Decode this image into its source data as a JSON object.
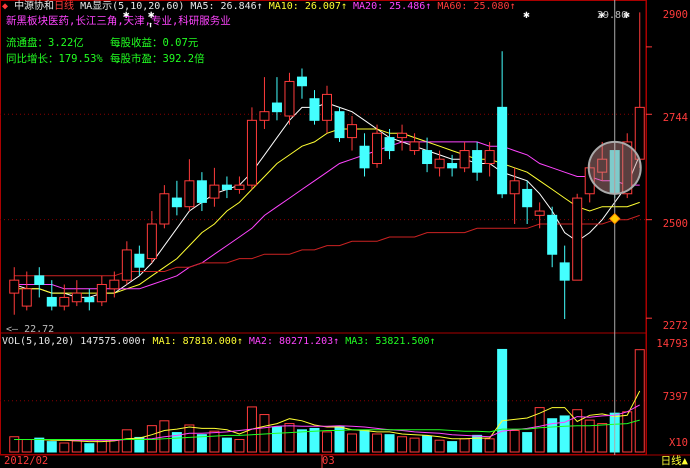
{
  "stock": {
    "name": "中源协和",
    "period": "日线",
    "ma_title": "MA显示(5,10,20,60)",
    "ma5": "MA5: 26.846↑",
    "ma10": "MA10: 26.007↑",
    "ma20": "MA20: 25.486↑",
    "ma60": "MA60: 25.080↑"
  },
  "info": {
    "tags": "新黑板块医药,长江三角,天津,专业,科研服务业",
    "float_label": "流通盘：",
    "float_value": "3.22亿",
    "eps_label": "每股收益：",
    "eps_value": "0.07元",
    "growth_label": "同比增长：",
    "growth_value": "179.53%",
    "pe_label": "每股市盈：",
    "pe_value": "392.2倍"
  },
  "price_axis": {
    "top": "2900",
    "mid1": "2744",
    "mid2": "2500",
    "bottom": "2272"
  },
  "annotations": {
    "high": "29.80",
    "low": "22.72"
  },
  "volume": {
    "title": "VOL(5,10,20)",
    "vol": "147575.000↑",
    "ma1": "MA1: 87810.000↑",
    "ma2": "MA2: 80271.203↑",
    "ma3": "MA3: 53821.500↑",
    "axis_top": "14793",
    "axis_mid": "7397",
    "axis_unit": "X10"
  },
  "bottom": {
    "date_left": "2012/02",
    "date_mid": "03",
    "period_tab": "日线"
  },
  "colors": {
    "up": "#ff3b3b",
    "down": "#44ffff",
    "ma5": "#ffffff",
    "ma10": "#ffff33",
    "ma20": "#ff44ff",
    "ma60": "#cc2222"
  },
  "candles": [
    {
      "o": 23.3,
      "c": 23.6,
      "h": 23.9,
      "l": 22.8,
      "v": 2200
    },
    {
      "o": 23.0,
      "c": 23.4,
      "h": 23.8,
      "l": 22.9,
      "v": 1800
    },
    {
      "o": 23.7,
      "c": 23.5,
      "h": 23.9,
      "l": 23.2,
      "v": 2000
    },
    {
      "o": 23.2,
      "c": 23.0,
      "h": 23.6,
      "l": 22.9,
      "v": 1500
    },
    {
      "o": 23.0,
      "c": 23.2,
      "h": 23.5,
      "l": 22.9,
      "v": 1300
    },
    {
      "o": 23.1,
      "c": 23.3,
      "h": 23.6,
      "l": 23.0,
      "v": 1600
    },
    {
      "o": 23.2,
      "c": 23.1,
      "h": 23.4,
      "l": 22.9,
      "v": 1200
    },
    {
      "o": 23.1,
      "c": 23.5,
      "h": 23.7,
      "l": 23.0,
      "v": 1800
    },
    {
      "o": 23.4,
      "c": 23.6,
      "h": 23.8,
      "l": 23.2,
      "v": 1700
    },
    {
      "o": 23.6,
      "c": 24.3,
      "h": 24.5,
      "l": 23.5,
      "v": 3200
    },
    {
      "o": 24.2,
      "c": 23.9,
      "h": 24.4,
      "l": 23.7,
      "v": 2100
    },
    {
      "o": 24.1,
      "c": 24.9,
      "h": 25.2,
      "l": 24.0,
      "v": 3800
    },
    {
      "o": 24.9,
      "c": 25.6,
      "h": 25.8,
      "l": 24.8,
      "v": 4500
    },
    {
      "o": 25.5,
      "c": 25.3,
      "h": 25.9,
      "l": 25.1,
      "v": 2800
    },
    {
      "o": 25.3,
      "c": 25.9,
      "h": 26.4,
      "l": 25.2,
      "v": 3900
    },
    {
      "o": 25.9,
      "c": 25.4,
      "h": 26.1,
      "l": 25.2,
      "v": 2500
    },
    {
      "o": 25.5,
      "c": 25.8,
      "h": 26.2,
      "l": 25.3,
      "v": 3000
    },
    {
      "o": 25.8,
      "c": 25.7,
      "h": 26.0,
      "l": 25.5,
      "v": 2000
    },
    {
      "o": 25.7,
      "c": 25.8,
      "h": 26.0,
      "l": 25.6,
      "v": 1800
    },
    {
      "o": 25.8,
      "c": 27.3,
      "h": 27.6,
      "l": 25.7,
      "v": 6500
    },
    {
      "o": 27.3,
      "c": 27.5,
      "h": 28.3,
      "l": 27.1,
      "v": 5400
    },
    {
      "o": 27.7,
      "c": 27.5,
      "h": 28.3,
      "l": 27.3,
      "v": 3600
    },
    {
      "o": 27.4,
      "c": 28.2,
      "h": 28.4,
      "l": 27.2,
      "v": 4100
    },
    {
      "o": 28.3,
      "c": 28.1,
      "h": 28.5,
      "l": 27.8,
      "v": 3200
    },
    {
      "o": 27.8,
      "c": 27.3,
      "h": 28.0,
      "l": 27.2,
      "v": 3400
    },
    {
      "o": 27.3,
      "c": 27.9,
      "h": 28.1,
      "l": 27.0,
      "v": 2900
    },
    {
      "o": 27.5,
      "c": 26.9,
      "h": 27.6,
      "l": 26.8,
      "v": 3700
    },
    {
      "o": 26.9,
      "c": 27.2,
      "h": 27.4,
      "l": 26.6,
      "v": 2600
    },
    {
      "o": 26.7,
      "c": 26.2,
      "h": 27.0,
      "l": 26.0,
      "v": 3100
    },
    {
      "o": 26.3,
      "c": 27.0,
      "h": 27.2,
      "l": 26.2,
      "v": 2600
    },
    {
      "o": 26.9,
      "c": 26.6,
      "h": 27.1,
      "l": 26.4,
      "v": 2500
    },
    {
      "o": 26.9,
      "c": 27.0,
      "h": 27.2,
      "l": 26.6,
      "v": 2200
    },
    {
      "o": 26.6,
      "c": 26.8,
      "h": 27.0,
      "l": 26.5,
      "v": 2000
    },
    {
      "o": 26.6,
      "c": 26.3,
      "h": 26.9,
      "l": 26.1,
      "v": 2300
    },
    {
      "o": 26.2,
      "c": 26.4,
      "h": 26.6,
      "l": 26.0,
      "v": 1700
    },
    {
      "o": 26.3,
      "c": 26.2,
      "h": 26.5,
      "l": 26.0,
      "v": 1500
    },
    {
      "o": 26.2,
      "c": 26.6,
      "h": 26.8,
      "l": 26.1,
      "v": 1900
    },
    {
      "o": 26.6,
      "c": 26.1,
      "h": 26.8,
      "l": 25.9,
      "v": 2400
    },
    {
      "o": 26.3,
      "c": 26.6,
      "h": 26.8,
      "l": 26.0,
      "v": 1900
    },
    {
      "o": 27.6,
      "c": 25.6,
      "h": 28.9,
      "l": 25.5,
      "v": 14793
    },
    {
      "o": 25.6,
      "c": 25.9,
      "h": 26.2,
      "l": 24.9,
      "v": 3100
    },
    {
      "o": 25.7,
      "c": 25.3,
      "h": 25.9,
      "l": 24.9,
      "v": 2800
    },
    {
      "o": 25.1,
      "c": 25.2,
      "h": 25.4,
      "l": 24.8,
      "v": 6400
    },
    {
      "o": 25.1,
      "c": 24.2,
      "h": 25.3,
      "l": 23.9,
      "v": 4800
    },
    {
      "o": 24.0,
      "c": 23.6,
      "h": 24.4,
      "l": 22.7,
      "v": 5200
    },
    {
      "o": 23.6,
      "c": 25.5,
      "h": 25.6,
      "l": 23.6,
      "v": 6100
    },
    {
      "o": 25.6,
      "c": 26.2,
      "h": 26.3,
      "l": 25.4,
      "v": 4600
    },
    {
      "o": 26.1,
      "c": 26.4,
      "h": 26.8,
      "l": 25.9,
      "v": 4100
    },
    {
      "o": 26.6,
      "c": 25.6,
      "h": 26.8,
      "l": 25.5,
      "v": 5600
    },
    {
      "o": 25.6,
      "c": 26.8,
      "h": 27.0,
      "l": 25.5,
      "v": 5800
    },
    {
      "o": 26.4,
      "c": 27.6,
      "h": 29.8,
      "l": 26.2,
      "v": 14757
    }
  ],
  "ma_lines": {
    "ma5": [
      23.5,
      23.4,
      23.4,
      23.3,
      23.3,
      23.2,
      23.2,
      23.3,
      23.3,
      23.5,
      23.7,
      24.0,
      24.4,
      24.8,
      25.2,
      25.4,
      25.6,
      25.7,
      25.8,
      26.1,
      26.5,
      26.9,
      27.3,
      27.6,
      27.6,
      27.7,
      27.6,
      27.5,
      27.3,
      27.1,
      26.9,
      26.8,
      26.7,
      26.6,
      26.5,
      26.4,
      26.4,
      26.3,
      26.3,
      26.1,
      26.0,
      25.9,
      25.6,
      25.2,
      24.7,
      24.5,
      24.7,
      25.0,
      25.4,
      25.8,
      26.5
    ],
    "ma10": [
      23.4,
      23.4,
      23.4,
      23.3,
      23.3,
      23.3,
      23.3,
      23.3,
      23.3,
      23.4,
      23.5,
      23.7,
      23.9,
      24.1,
      24.4,
      24.7,
      24.9,
      25.2,
      25.4,
      25.7,
      26.0,
      26.3,
      26.5,
      26.7,
      26.8,
      27.0,
      27.1,
      27.1,
      27.1,
      27.1,
      27.0,
      27.0,
      26.9,
      26.8,
      26.7,
      26.6,
      26.5,
      26.4,
      26.4,
      26.3,
      26.2,
      26.1,
      25.9,
      25.7,
      25.5,
      25.3,
      25.2,
      25.3,
      25.3,
      25.3,
      25.4
    ],
    "ma20": [
      23.5,
      23.5,
      23.5,
      23.5,
      23.4,
      23.4,
      23.4,
      23.4,
      23.4,
      23.4,
      23.4,
      23.5,
      23.6,
      23.7,
      23.9,
      24.0,
      24.2,
      24.4,
      24.6,
      24.8,
      25.1,
      25.3,
      25.5,
      25.7,
      25.9,
      26.1,
      26.3,
      26.4,
      26.5,
      26.6,
      26.7,
      26.8,
      26.8,
      26.8,
      26.8,
      26.8,
      26.8,
      26.8,
      26.7,
      26.7,
      26.6,
      26.5,
      26.3,
      26.2,
      26.1,
      26.0,
      26.0,
      25.9,
      25.9,
      25.8,
      25.8
    ],
    "ma60": [
      23.7,
      23.7,
      23.7,
      23.7,
      23.7,
      23.7,
      23.7,
      23.7,
      23.7,
      23.8,
      23.8,
      23.8,
      23.8,
      23.9,
      23.9,
      24.0,
      24.0,
      24.0,
      24.1,
      24.1,
      24.2,
      24.2,
      24.2,
      24.3,
      24.3,
      24.4,
      24.4,
      24.5,
      24.5,
      24.5,
      24.6,
      24.6,
      24.6,
      24.7,
      24.7,
      24.7,
      24.7,
      24.8,
      24.8,
      24.8,
      24.8,
      24.8,
      24.9,
      24.9,
      24.9,
      24.9,
      24.9,
      24.9,
      25.0,
      25.0,
      25.1
    ]
  },
  "vol_ma": {
    "ma1": [
      1800,
      1800,
      1800,
      1700,
      1700,
      1600,
      1500,
      1500,
      1600,
      1900,
      2000,
      2500,
      3100,
      3300,
      3600,
      3400,
      3400,
      3200,
      2600,
      3300,
      3700,
      4100,
      4800,
      4500,
      3900,
      3600,
      3600,
      3200,
      3100,
      2900,
      2900,
      2600,
      2500,
      2400,
      2200,
      1900,
      1900,
      2000,
      2000,
      4500,
      4700,
      4900,
      5600,
      6400,
      6400,
      4400,
      5300,
      5500,
      5100,
      5300,
      8800
    ],
    "ma2": [
      1800,
      1800,
      1800,
      1800,
      1800,
      1700,
      1700,
      1700,
      1700,
      1800,
      1800,
      1900,
      2200,
      2400,
      2700,
      2700,
      2800,
      2900,
      3100,
      3300,
      3500,
      3700,
      3800,
      3700,
      3700,
      3700,
      3800,
      3700,
      3600,
      3400,
      3200,
      3100,
      2900,
      2800,
      2700,
      2500,
      2400,
      2300,
      2200,
      3000,
      3200,
      3400,
      3700,
      4100,
      4300,
      5100,
      5000,
      5200,
      5300,
      5800,
      6800
    ],
    "ma3": [
      1800,
      1800,
      1800,
      1800,
      1800,
      1800,
      1800,
      1800,
      1800,
      1800,
      1800,
      1800,
      1900,
      2000,
      2100,
      2200,
      2300,
      2400,
      2400,
      2500,
      2600,
      2700,
      2800,
      2900,
      3000,
      3100,
      3100,
      3200,
      3200,
      3200,
      3200,
      3200,
      3200,
      3200,
      3200,
      3100,
      3000,
      3000,
      2900,
      3300,
      3300,
      3300,
      3500,
      3600,
      3700,
      3800,
      3800,
      3900,
      4000,
      4100,
      4600
    ]
  }
}
